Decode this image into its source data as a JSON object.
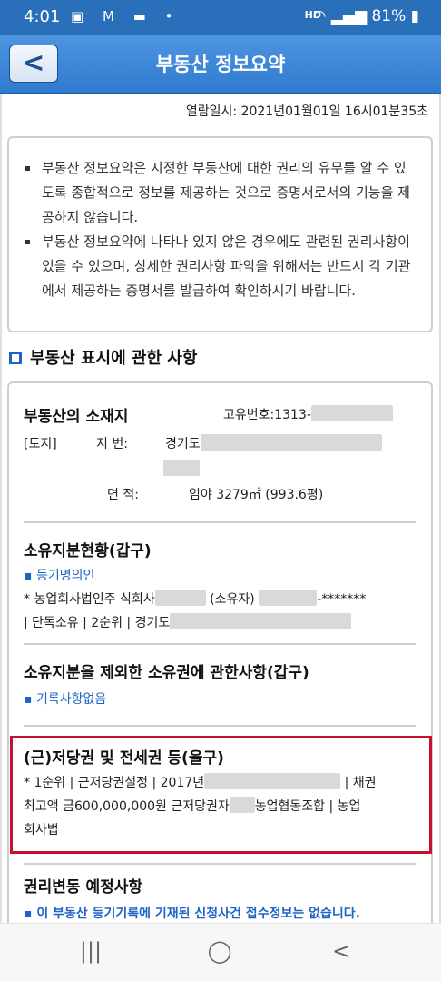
{
  "status_bar": {
    "time": "4:01",
    "notif_icons": "▣ M ▬ •",
    "hd": "HD",
    "battery": "81%"
  },
  "header": {
    "title": "부동산 정보요약",
    "back_label": "<"
  },
  "view_time": "열람일시: 2021년01월01일 16시01분35초",
  "notice": {
    "items": [
      "부동산 정보요약은 지정한 부동산에 대한 권리의 유무를 알 수 있도록 종합적으로 정보를 제공하는 것으로 증명서로서의 기능을 제공하지 않습니다.",
      "부동산 정보요약에 나타나 있지 않은 경우에도 관련된 권리사항이 있을 수 있으며, 상세한 권리사항 파악을 위해서는 반드시 각 기관에서 제공하는 증명서를 발급하여 확인하시기 바랍니다."
    ]
  },
  "section_title": "부동산 표시에 관한 사항",
  "location": {
    "title": "부동산의 소재지",
    "unique_no": "고유번호:1313-",
    "type": "[토지]",
    "lot_label": "지      번:",
    "lot_value": "경기도",
    "area_label": "면      적:",
    "area_value": "임야 3279㎡ (993.6평)"
  },
  "ownership": {
    "title": "소유지분현황(갑구)",
    "registrant": "▪ 등기명의인",
    "line1_a": "* 농업회사법인주 식회사",
    "line1_b": "(소유자)",
    "line1_c": "-*******",
    "line2": "| 단독소유 | 2순위 | 경기도"
  },
  "other_rights": {
    "title": "소유지분을 제외한 소유권에 관한사항(갑구)",
    "status": "▪ 기록사항없음"
  },
  "mortgage": {
    "title": "(근)저당권 및 전세권 등(을구)",
    "line1_a": "* 1순위 | 근저당권설정 | 2017년",
    "line1_b": "| 채권",
    "line2_a": "최고액 금600,000,000원 근저당권자",
    "line2_b": "농업협동조합 | 농업",
    "line3": "회사법"
  },
  "pending": {
    "title": "권리변동 예정사항",
    "status": "▪ 이 부동산 등기기록에 기재된 신청사건 접수정보는 없습니다."
  },
  "nav": {
    "recent": "|||",
    "home": "◯",
    "back": "<"
  }
}
